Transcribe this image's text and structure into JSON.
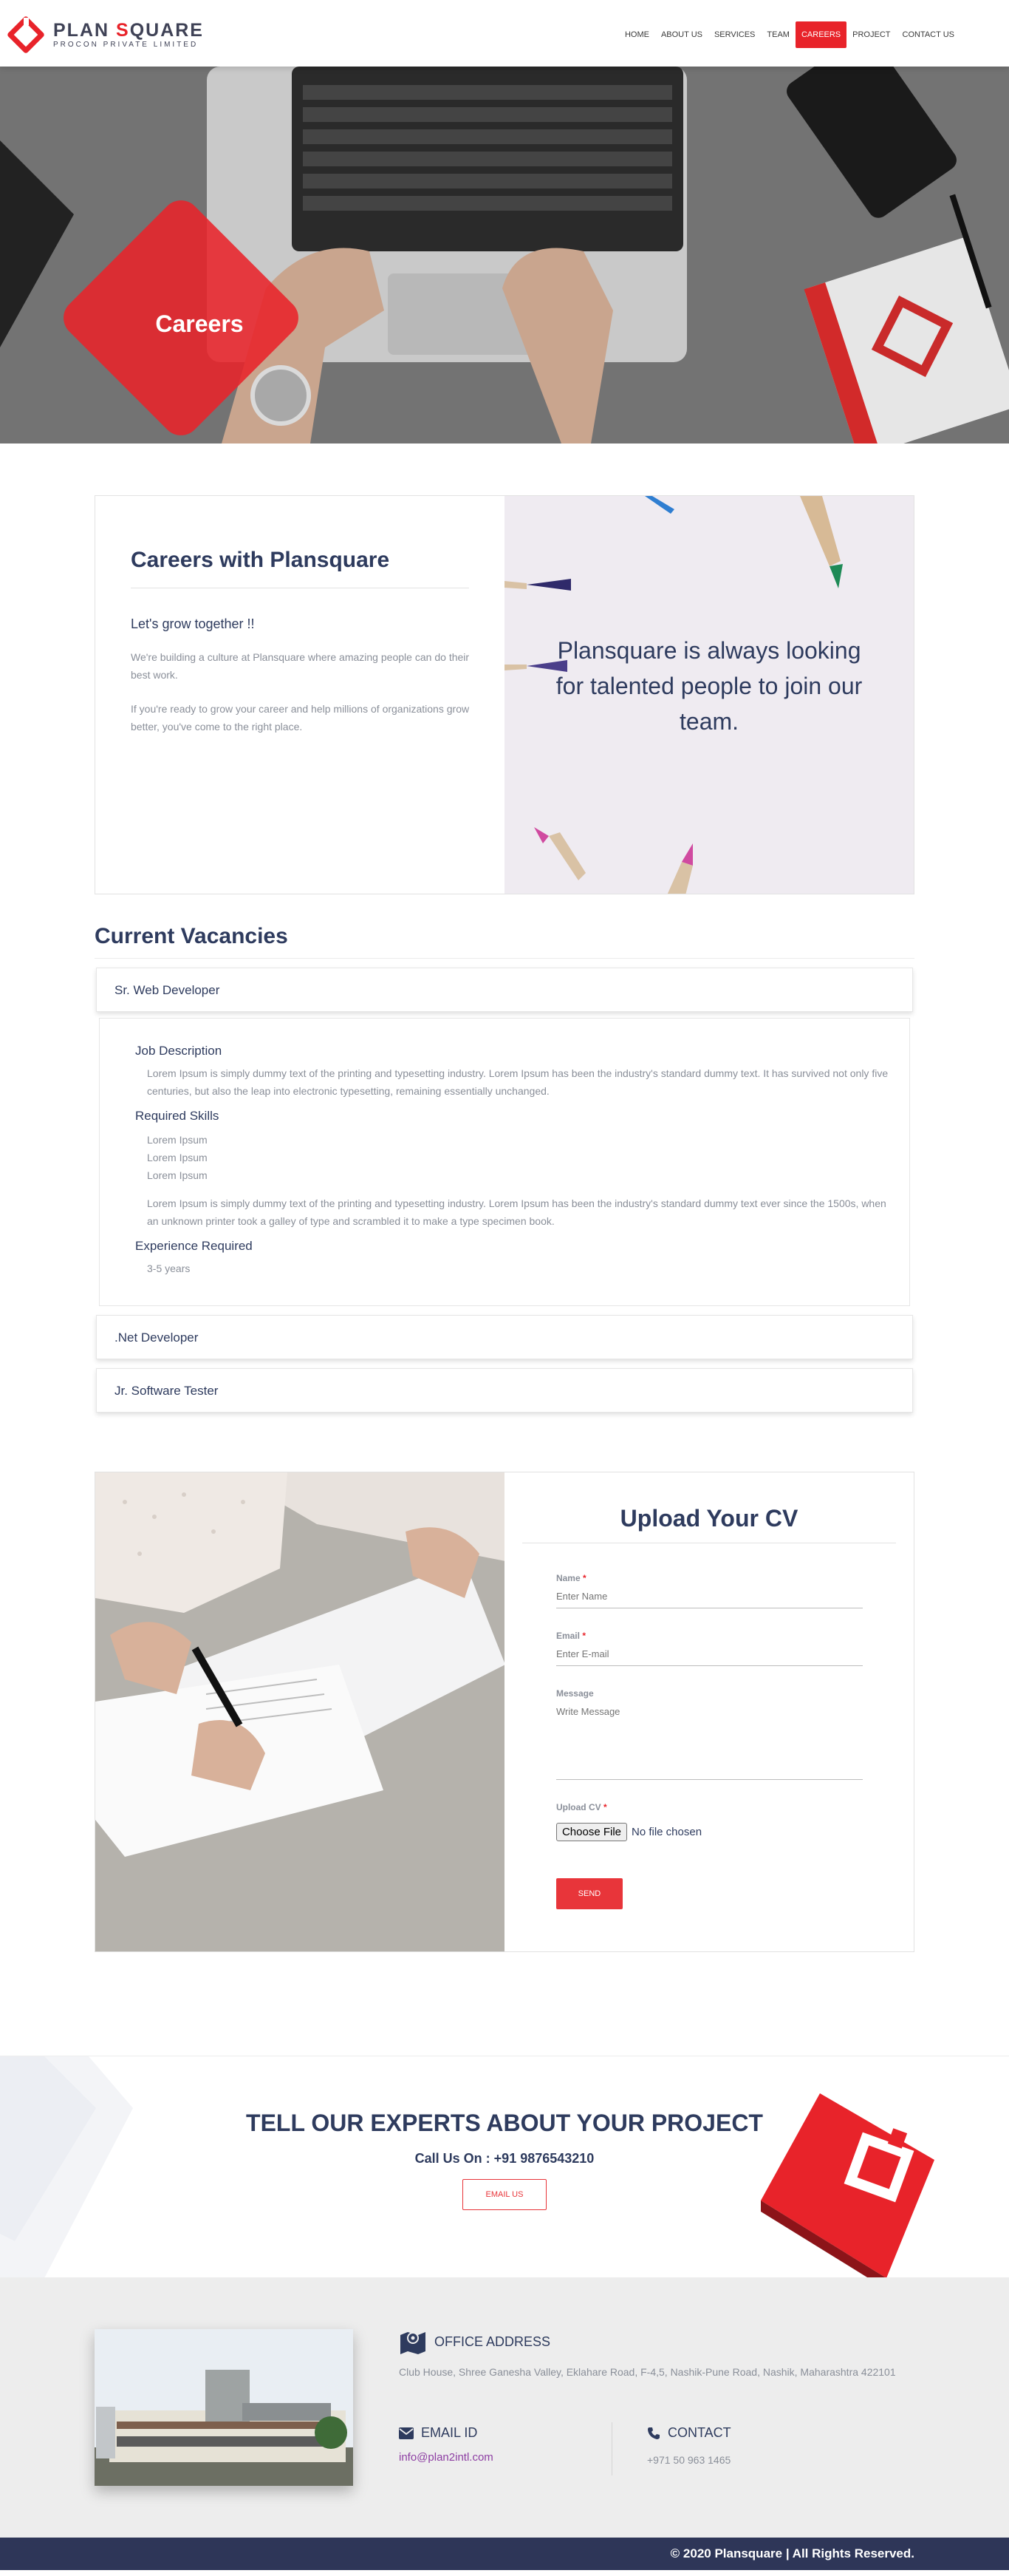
{
  "header": {
    "logo_title_a": "PLAN ",
    "logo_title_b": "S",
    "logo_title_c": "QUARE",
    "logo_sub": "PROCON PRIVATE LIMITED",
    "nav": [
      "HOME",
      "ABOUT US",
      "SERVICES",
      "TEAM",
      "CAREERS",
      "PROJECT",
      "CONTACT US"
    ],
    "active_nav": "CAREERS"
  },
  "hero": {
    "title": "Careers"
  },
  "intro": {
    "heading": "Careers with Plansquare",
    "subheading": "Let's grow together !!",
    "p1": "We're building a culture at Plansquare where amazing people can do their best work.",
    "p2": "If you're ready to grow your career and help millions of organizations grow better, you've come to the right place.",
    "quote": "Plansquare is always looking for talented people to join our team."
  },
  "vacancies": {
    "heading": "Current Vacancies",
    "items": [
      ".Net Developer",
      "Jr. Software Tester"
    ],
    "open": {
      "title": "Sr. Web Developer",
      "job_desc_label": "Job Description",
      "job_desc": "Lorem Ipsum is simply dummy text of the printing and typesetting industry. Lorem Ipsum has been the industry's standard dummy text. It has survived not only five centuries, but also the leap into electronic typesetting, remaining essentially unchanged.",
      "skills_label": "Required Skills",
      "skills": [
        "Lorem Ipsum",
        "Lorem Ipsum",
        "Lorem Ipsum"
      ],
      "skills_desc": "Lorem Ipsum is simply dummy text of the printing and typesetting industry. Lorem Ipsum has been the industry's standard dummy text ever since the 1500s, when an unknown printer took a galley of type and scrambled it to make a type specimen book.",
      "exp_label": "Experience Required",
      "exp": "3-5 years"
    }
  },
  "cv_form": {
    "title": "Upload Your CV",
    "name_label": "Name",
    "name_placeholder": "Enter Name",
    "email_label": "Email",
    "email_placeholder": "Enter E-mail",
    "message_label": "Message",
    "message_placeholder": "Write Message",
    "cv_label": "Upload CV",
    "required_mark": "*",
    "file_button": "Choose File",
    "file_status": "No file chosen",
    "send_label": "SEND"
  },
  "cta": {
    "title": "TELL OUR EXPERTS ABOUT YOUR PROJECT",
    "call": "Call Us On : +91 9876543210",
    "button": "EMAIL US"
  },
  "footer": {
    "office_label": "OFFICE ADDRESS",
    "office_address": "Club House, Shree Ganesha Valley, Eklahare Road, F-4,5, Nashik-Pune Road, Nashik, Maharashtra 422101",
    "email_label": "EMAIL ID",
    "email_value": "info@plan2intl.com",
    "contact_label": "CONTACT",
    "contact_value": "+971 50 963 1465",
    "copyright": "© 2020 Plansquare | All Rights Reserved."
  },
  "colors": {
    "brand_red": "#e8232a",
    "navy": "#2e3b5e",
    "footer_bar": "#2e3658"
  },
  "icons": [
    "logo-mark",
    "map-icon",
    "envelope-icon",
    "phone-icon"
  ]
}
